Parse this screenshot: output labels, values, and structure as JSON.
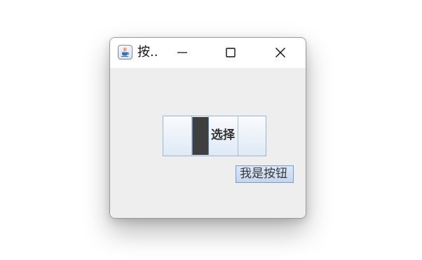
{
  "window": {
    "title": "按..",
    "app_icon": "java-cup-icon",
    "controls": {
      "minimize": "minimize-icon",
      "maximize": "maximize-icon",
      "close": "close-icon"
    }
  },
  "content": {
    "toggle": {
      "label": "选择"
    },
    "button": {
      "label": "我是按钮"
    }
  },
  "colors": {
    "window_bg": "#eeeeee",
    "titlebar_bg": "#ffffff",
    "thumb": "#3f3f3f",
    "control_border": "#9bb5d2",
    "button_border": "#7a9bcf"
  }
}
